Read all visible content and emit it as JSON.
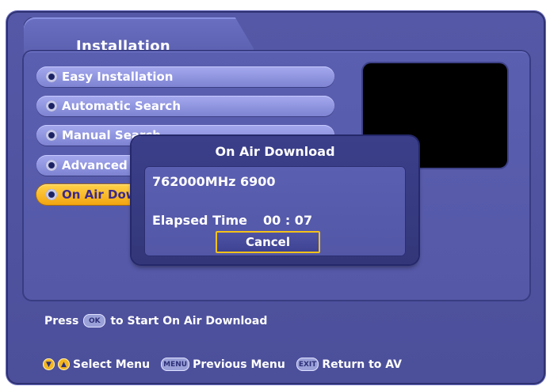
{
  "header": {
    "title": "Installation"
  },
  "menu": {
    "items": [
      {
        "label": "Easy Installation"
      },
      {
        "label": "Automatic Search"
      },
      {
        "label": "Manual Search"
      },
      {
        "label": "Advanced"
      },
      {
        "label": "On Air Download",
        "active": true
      }
    ]
  },
  "dialog": {
    "title": "On Air Download",
    "frequency": "762000MHz 6900",
    "elapsed_label": "Elapsed Time",
    "elapsed_value": "00 : 07",
    "cancel_label": "Cancel"
  },
  "hint": {
    "prefix": "Press",
    "key": "OK",
    "suffix": "to Start On Air Download"
  },
  "footer": {
    "nav_label": "Select Menu",
    "menu_key": "MENU",
    "menu_label": "Previous Menu",
    "exit_key": "EXIT",
    "exit_label": "Return to AV"
  },
  "colors": {
    "panel": "#5458a6",
    "active": "#f3a510",
    "focus_border": "#f4c21a"
  }
}
